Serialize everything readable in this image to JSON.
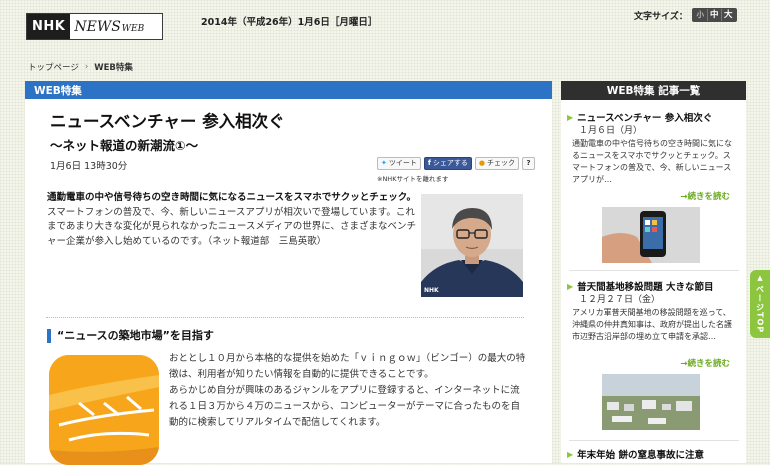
{
  "header": {
    "logo_nhk": "NHK",
    "logo_news": "NEWS",
    "logo_web": "WEB",
    "date": "2014年（平成26年）1月6日［月曜日］",
    "font_size_label": "文字サイズ：",
    "font_sizes": [
      "小",
      "中",
      "大"
    ]
  },
  "breadcrumb": {
    "home": "トップページ",
    "separator": "›",
    "current": "WEB特集"
  },
  "article": {
    "tab_label": "WEB特集",
    "title": "ニュースベンチャー 参入相次ぐ",
    "subtitle": "～ネット報道の新潮流①～",
    "published": "1月6日 13時30分",
    "social": {
      "tweet": "ツイート",
      "share": "シェアする",
      "check": "チェック",
      "help": "?"
    },
    "nhk_site_note": "※NHKサイトを離れます",
    "lead_bold": "通勤電車の中や信号待ちの空き時間に気になるニュースをスマホでサクッとチェック。",
    "lead_text": "スマートフォンの普及で、今、新しいニュースアプリが相次いで登場しています。これまであまり大きな変化が見られなかったニュースメディアの世界に、さまざまなベンチャー企業が参入し始めているのです。（ネット報道部　三島英歌）",
    "photo_credit": "NHK",
    "section_heading": "“ニュースの築地市場”を目指す",
    "section_p1": "おととし１０月から本格的な提供を始めた「ｖｉｎｇｏｗ」（ビンゴー）の最大の特徴は、利用者が知りたい情報を自動的に提供できることです。",
    "section_p2": "あらかじめ自分が興味のあるジャンルをアプリに登録すると、インターネットに流れる１日３万から４万のニュースから、コンピューターがテーマに合ったものを自動的に検索してリアルタイムで配信してくれます。"
  },
  "sidebar": {
    "title": "WEB特集 記事一覧",
    "items": [
      {
        "title": "ニュースベンチャー 参入相次ぐ",
        "date": "１月６日（月）",
        "summary": "通勤電車の中や信号待ちの空き時間に気になるニュースをスマホでサクッとチェック。スマートフォンの普及で、今、新しいニュースアプリが…",
        "more": "→続きを読む"
      },
      {
        "title": "普天間基地移設問題 大きな節目",
        "date": "１２月２７日（金）",
        "summary": "アメリカ軍普天間基地の移設問題を巡って、沖縄県の仲井真知事は、政府が提出した名護市辺野古沿岸部の埋め立て申請を承認…",
        "more": "→続きを読む"
      },
      {
        "title": "年末年始 餅の窒息事故に注意"
      }
    ]
  },
  "page_top": "ページTOP",
  "colors": {
    "accent_blue": "#2d73c5",
    "sidebar_header": "#2f2f2f",
    "more_link_green": "#6aaa1e",
    "page_top_green": "#8cc63f"
  }
}
